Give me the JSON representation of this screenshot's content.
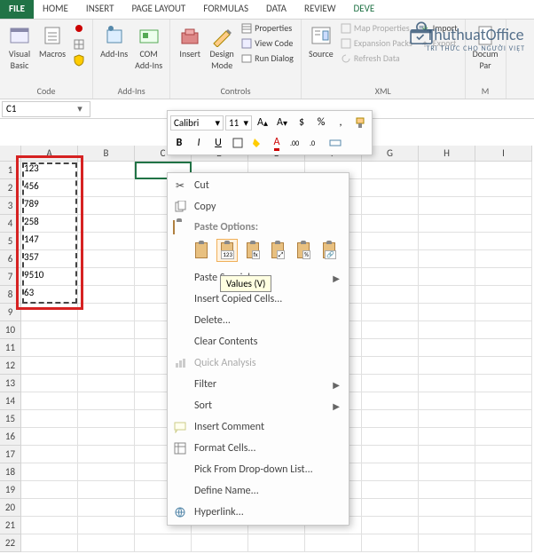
{
  "tabs": {
    "file": "FILE",
    "home": "HOME",
    "insert": "INSERT",
    "pageLayout": "PAGE LAYOUT",
    "formulas": "FORMULAS",
    "data": "DATA",
    "review": "REVIEW",
    "developer": "DEVE"
  },
  "ribbon": {
    "code": {
      "visualBasic": "Visual\nBasic",
      "macros": "Macros",
      "label": "Code"
    },
    "addins": {
      "addins": "Add-Ins",
      "com": "COM\nAdd-Ins",
      "label": "Add-Ins"
    },
    "controls": {
      "insert": "Insert",
      "design": "Design\nMode",
      "properties": "Properties",
      "viewCode": "View Code",
      "runDialog": "Run Dialog",
      "label": "Controls"
    },
    "xml": {
      "source": "Source",
      "mapProps": "Map Properties",
      "expansion": "Expansion Packs",
      "refresh": "Refresh Data",
      "import": "Import",
      "export": "Export",
      "label": "XML"
    },
    "modify": {
      "document": "Docum\nPar",
      "label": "M"
    }
  },
  "nameBox": "C1",
  "miniToolbar": {
    "font": "Calibri",
    "size": "11",
    "currency": "$",
    "percent": "%"
  },
  "contextMenu": {
    "cut": "Cut",
    "copy": "Copy",
    "pasteHeader": "Paste Options:",
    "pasteSpecial": "Paste Special...",
    "insertCopied": "Insert Copied Cells...",
    "delete": "Delete...",
    "clear": "Clear Contents",
    "quick": "Quick Analysis",
    "filter": "Filter",
    "sort": "Sort",
    "comment": "Insert Comment",
    "format": "Format Cells...",
    "dropdown": "Pick From Drop-down List...",
    "defineName": "Define Name...",
    "hyperlink": "Hyperlink...",
    "tooltip": "Values (V)",
    "pasteOptBadges": {
      "values": "123",
      "formulas": "fx",
      "format": "%"
    }
  },
  "columns": [
    "A",
    "B",
    "C",
    "D",
    "E",
    "F",
    "G",
    "H",
    "I"
  ],
  "rowCount": 22,
  "cellData": {
    "A1": "123",
    "A2": "456",
    "A3": "789",
    "A4": "258",
    "A5": "147",
    "A6": "357",
    "A7": "9510",
    "A8": "63"
  },
  "watermark": {
    "main": "ThuthuatOffice",
    "sub": "TRI THỨC CHO NGƯỜI VIỆT"
  }
}
